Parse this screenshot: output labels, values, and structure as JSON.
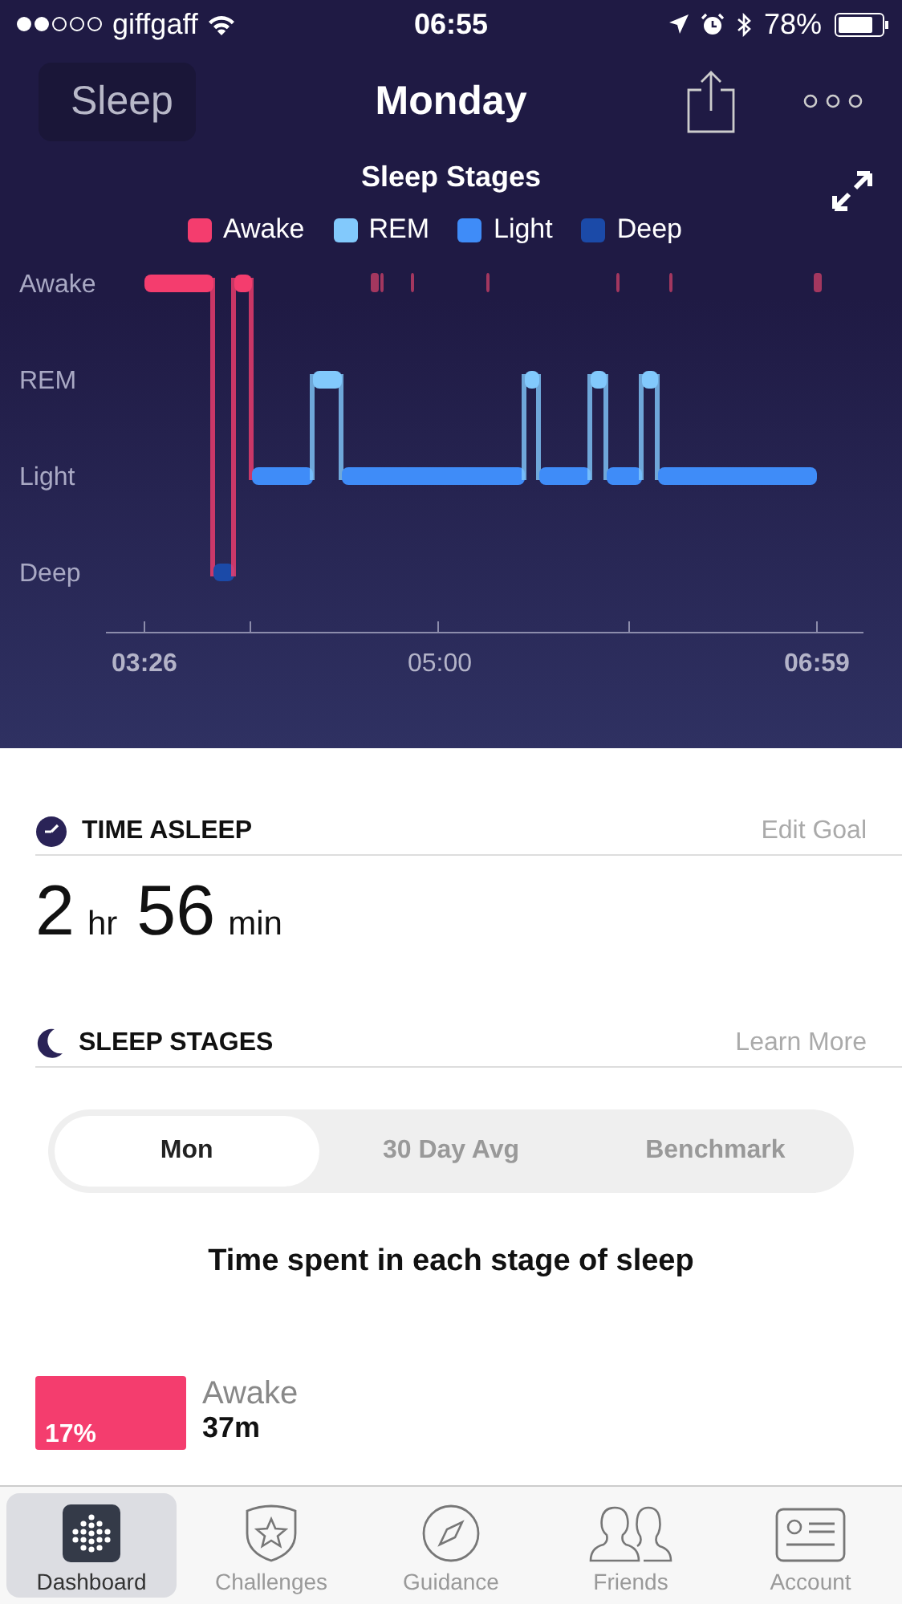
{
  "status_bar": {
    "carrier": "giffgaff",
    "time": "06:55",
    "battery": "78%"
  },
  "nav": {
    "back": "Sleep",
    "title": "Monday"
  },
  "chart": {
    "title": "Sleep Stages",
    "legend": [
      {
        "label": "Awake",
        "color": "#f43d6e"
      },
      {
        "label": "REM",
        "color": "#82c9fc"
      },
      {
        "label": "Light",
        "color": "#3f8cf8"
      },
      {
        "label": "Deep",
        "color": "#1b4aa8"
      }
    ],
    "y_labels": [
      "Awake",
      "REM",
      "Light",
      "Deep"
    ],
    "x_labels": [
      "03:26",
      "05:00",
      "06:59"
    ]
  },
  "time_asleep": {
    "title": "TIME ASLEEP",
    "link": "Edit Goal",
    "parts": [
      {
        "value": "2",
        "unit": "hr"
      },
      {
        "value": "56",
        "unit": "min"
      }
    ]
  },
  "sleep_stages": {
    "title": "SLEEP STAGES",
    "link": "Learn More",
    "tabs": [
      {
        "label": "Mon",
        "selected": true
      },
      {
        "label": "30 Day Avg",
        "selected": false
      },
      {
        "label": "Benchmark",
        "selected": false
      }
    ],
    "caption": "Time spent in each stage of sleep",
    "stages": [
      {
        "name": "Awake",
        "percent": "17%",
        "duration": "37m",
        "color": "#f43d6e"
      }
    ]
  },
  "tab_bar": [
    {
      "label": "Dashboard",
      "kind": "dashboard",
      "selected": true
    },
    {
      "label": "Challenges",
      "kind": "challenges",
      "selected": false
    },
    {
      "label": "Guidance",
      "kind": "guidance",
      "selected": false
    },
    {
      "label": "Friends",
      "kind": "friends",
      "selected": false
    },
    {
      "label": "Account",
      "kind": "account",
      "selected": false
    }
  ]
}
